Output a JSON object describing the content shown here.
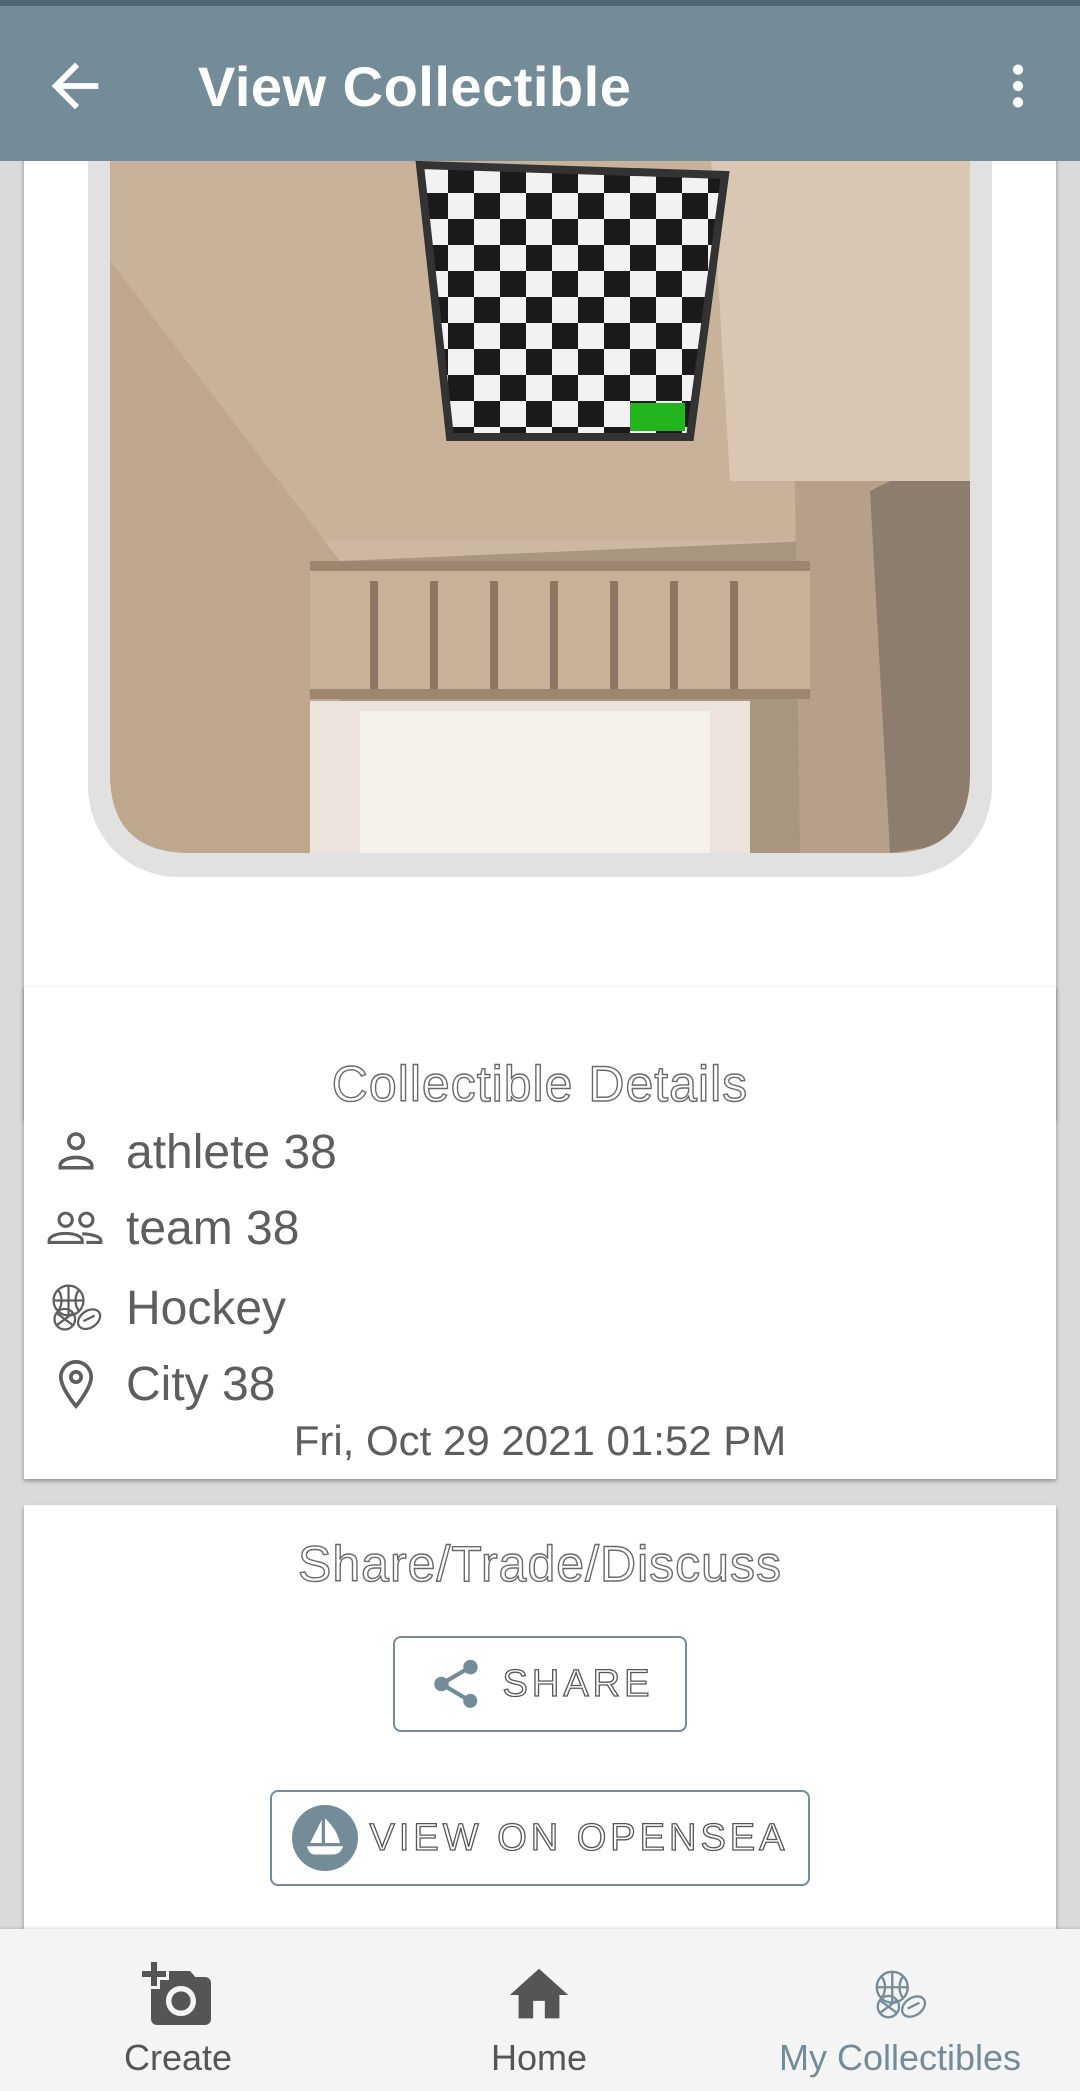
{
  "app_bar": {
    "title": "View Collectible",
    "back_icon": "arrow-left-icon",
    "menu_icon": "more-vertical-icon"
  },
  "image": {
    "description_icon": "collectible-photo"
  },
  "details": {
    "section_title": "Collectible Details",
    "athlete": "athlete 38",
    "team": "team 38",
    "sport": "Hockey",
    "city": "City 38",
    "date": "Fri, Oct 29 2021 01:52 PM"
  },
  "share": {
    "section_title": "Share/Trade/Discuss",
    "share_label": "SHARE",
    "opensea_label": "VIEW ON OPENSEA"
  },
  "bottom_nav": {
    "create": "Create",
    "home": "Home",
    "my_collectibles": "My Collectibles"
  },
  "colors": {
    "app_bar": "#738c98",
    "accent": "#738c98",
    "background": "#dadada"
  }
}
